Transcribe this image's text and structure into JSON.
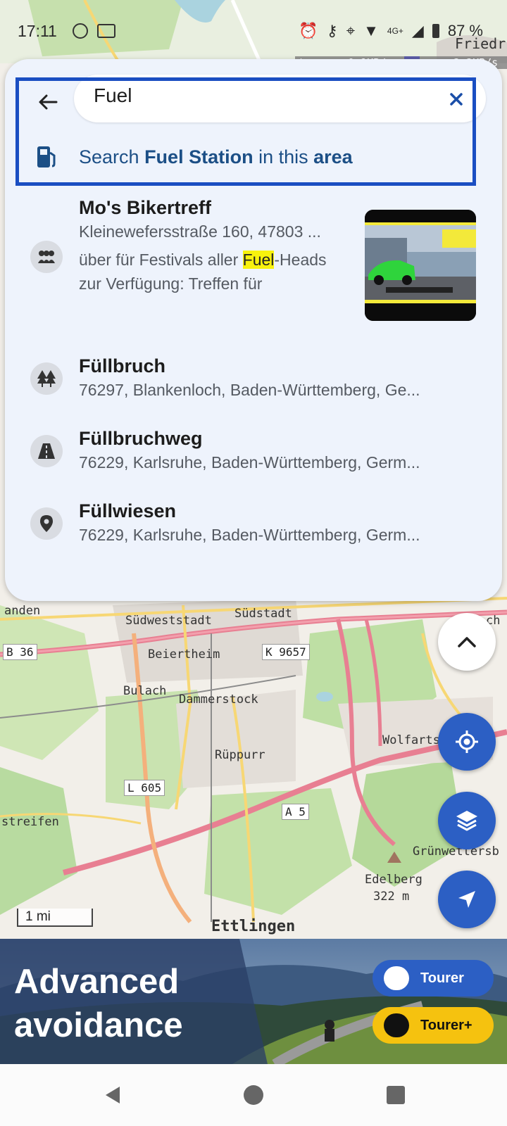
{
  "status": {
    "time": "17:11",
    "battery": "87 %",
    "net_up": "0.1KB/s",
    "net_down": "2.2KB/s",
    "signal": "4G+"
  },
  "search": {
    "query": "Fuel",
    "suggestion_prefix": "Search ",
    "suggestion_category": "Fuel Station",
    "suggestion_middle": " in this ",
    "suggestion_suffix": "area"
  },
  "results": [
    {
      "title": "Mo's Bikertreff",
      "address": "Kleinewefersstraße 160, 47803 ...",
      "snippet_before": "über für Festivals aller ",
      "snippet_highlight": "Fuel",
      "snippet_after": "-Heads zur Verfügung: Treffen für",
      "icon": "group-icon"
    },
    {
      "title": "Füllbruch",
      "address": "76297, Blankenloch, Baden-Württemberg, Ge...",
      "icon": "trees-icon"
    },
    {
      "title": "Füllbruchweg",
      "address": "76229, Karlsruhe, Baden-Württemberg, Germ...",
      "icon": "road-icon"
    },
    {
      "title": "Füllwiesen",
      "address": "76229, Karlsruhe, Baden-Württemberg, Germ...",
      "icon": "pin-icon"
    }
  ],
  "map": {
    "labels": {
      "friedr": "Friedric",
      "anden": "anden",
      "suedweststadt": "Südweststadt",
      "suedstadt": "Südstadt",
      "ch": "ch",
      "b36": "B 36",
      "beiertheim": "Beiertheim",
      "k9657": "K 9657",
      "bulach": "Bulach",
      "dammerstock": "Dammerstock",
      "wolfarts": "Wolfarts",
      "rueppurr": "Rüppurr",
      "l605": "L 605",
      "a5": "A 5",
      "streifen": "streifen",
      "gruenwettersb": "Grünwettersb",
      "edelberg": "Edelberg",
      "edelberg_alt": "322 m",
      "ettlingen": "Ettlingen"
    },
    "scale": "1 mi"
  },
  "banner": {
    "title_line1": "Advanced",
    "title_line2": "avoidance",
    "tourer": "Tourer",
    "tourer_plus": "Tourer+"
  },
  "colors": {
    "accent": "#2c5fc4",
    "focus": "#1a4ec2",
    "highlight": "#f8f20d",
    "tourer_plus": "#f5c20f",
    "panel": "#eef3fc"
  }
}
